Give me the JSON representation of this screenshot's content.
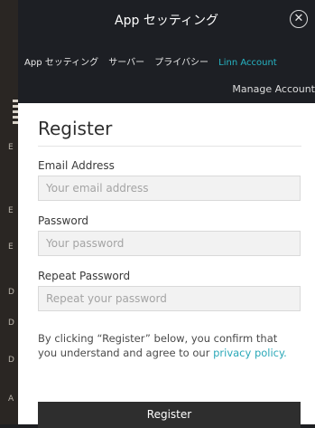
{
  "window": {
    "title": "App セッティング"
  },
  "tabs": [
    {
      "label": "App セッティング",
      "active": false
    },
    {
      "label": "サーバー",
      "active": false
    },
    {
      "label": "プライバシー",
      "active": false
    },
    {
      "label": "Linn Account",
      "active": true
    }
  ],
  "manage_account": "Manage Account",
  "register": {
    "title": "Register",
    "email_label": "Email Address",
    "email_placeholder": "Your email address",
    "password_label": "Password",
    "password_placeholder": "Your password",
    "repeat_label": "Repeat Password",
    "repeat_placeholder": "Repeat your password",
    "terms_text": "By clicking “Register” below, you confirm that you understand and agree to our ",
    "privacy_link": "privacy policy.",
    "button": "Register"
  },
  "background_letters": [
    "E",
    "E",
    "E",
    "D",
    "D",
    "D",
    "A"
  ],
  "colors": {
    "panel_bg": "#1d1f24",
    "accent": "#26b5c4",
    "button_bg": "#2e2e2e"
  },
  "icons": {
    "close": "close-circle-icon"
  }
}
